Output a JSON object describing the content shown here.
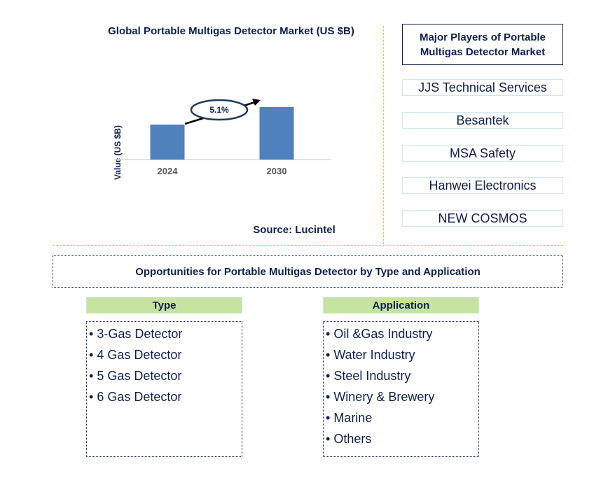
{
  "chart_data": {
    "type": "bar",
    "title": "Global Portable Multigas Detector Market (US $B)",
    "xlabel": "",
    "ylabel": "Value (US $B)",
    "categories": [
      "2024",
      "2030"
    ],
    "values": [
      1.0,
      1.5
    ],
    "value_note": "relative heights only; no axis values shown",
    "annotation": {
      "label": "5.1%",
      "meaning": "CAGR growth arrow from 2024 to 2030"
    },
    "bar_color": "#4f81bd",
    "grid": false,
    "legend": "none"
  },
  "source": "Source: Lucintel",
  "players": {
    "title": "Major Players of Portable Multigas Detector Market",
    "title_line1": "Major Players of Portable",
    "title_line2": "Multigas Detector Market",
    "items": [
      "JJS Technical Services",
      "Besantek",
      "MSA Safety",
      "Hanwei Electronics",
      "NEW COSMOS"
    ]
  },
  "opportunities": {
    "title": "Opportunities for Portable Multigas Detector by Type and Application",
    "type": {
      "header": "Type",
      "items": [
        "3-Gas Detector",
        "4 Gas Detector",
        "5 Gas Detector",
        "6 Gas Detector"
      ]
    },
    "application": {
      "header": "Application",
      "items": [
        "Oil &Gas Industry",
        "Water Industry",
        "Steel Industry",
        "Winery & Brewery",
        "Marine",
        "Others"
      ]
    }
  },
  "colors": {
    "text_navy": "#0d1f4f",
    "divider_gold": "#f2c12e",
    "header_green": "#c6e3a0",
    "bar_blue": "#4f81bd"
  }
}
